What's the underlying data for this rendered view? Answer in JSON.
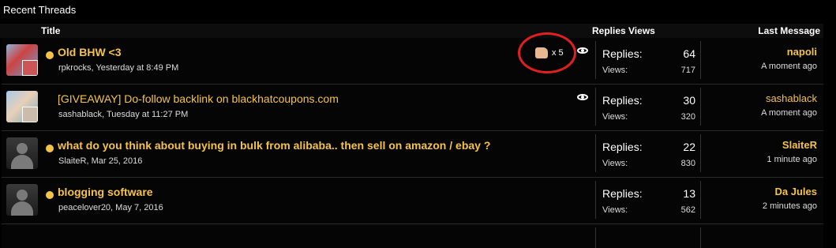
{
  "section_title": "Recent Threads",
  "header": {
    "title": "Title",
    "replies_views": "Replies Views",
    "last_message": "Last Message"
  },
  "labels": {
    "replies": "Replies:",
    "views": "Views:"
  },
  "threads": [
    {
      "title": "Old BHW <3",
      "meta": "rpkrocks, Yesterday at 8:49 PM",
      "replies": "64",
      "views": "717",
      "last_user": "napoli",
      "last_time": "A moment ago",
      "likes": "x 5",
      "avatar": "photo"
    },
    {
      "title": "[GIVEAWAY] Do-follow backlink on blackhatcoupons.com",
      "meta": "sashablack, Tuesday at 11:27 PM",
      "replies": "30",
      "views": "320",
      "last_user": "sashablack",
      "last_time": "A moment ago",
      "avatar": "photo"
    },
    {
      "title": "what do you think about buying in bulk from alibaba.. then sell on amazon / ebay ?",
      "meta": "SlaiteR, Mar 25, 2016",
      "replies": "22",
      "views": "830",
      "last_user": "SlaiteR",
      "last_time": "1 minute ago",
      "avatar": "default"
    },
    {
      "title": "blogging software",
      "meta": "peacelover20, May 7, 2016",
      "replies": "13",
      "views": "562",
      "last_user": "Da Jules",
      "last_time": "2 minutes ago",
      "avatar": "default"
    }
  ],
  "colors": {
    "accent": "#f5c34a",
    "annotation": "#e02020",
    "background": "#000000"
  }
}
